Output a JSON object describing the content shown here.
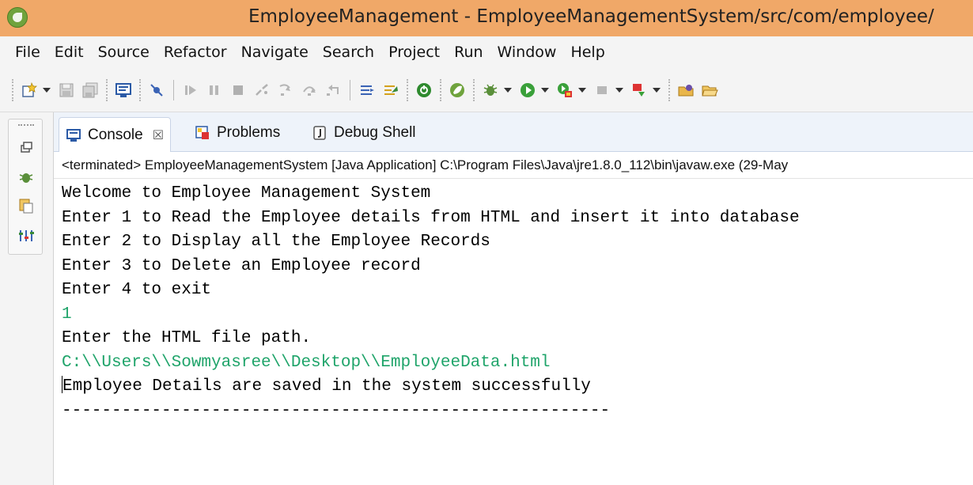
{
  "window": {
    "title": "EmployeeManagement - EmployeeManagementSystem/src/com/employee/"
  },
  "menu": [
    "File",
    "Edit",
    "Source",
    "Refactor",
    "Navigate",
    "Search",
    "Project",
    "Run",
    "Window",
    "Help"
  ],
  "toolbar": {
    "icons": [
      "new-wizard-icon",
      "save-icon",
      "save-all-icon",
      "open-console-icon",
      "skip-breakpoints-icon",
      "resume-icon",
      "suspend-icon",
      "terminate-icon",
      "disconnect-icon",
      "step-into-icon",
      "step-over-icon",
      "step-return-icon",
      "use-step-filters-icon",
      "drop-to-frame-icon",
      "spring-boot-icon",
      "spring-icon",
      "debug-icon",
      "run-icon",
      "coverage-icon",
      "stop-icon",
      "external-tools-icon",
      "open-type-icon",
      "open-folder-icon"
    ]
  },
  "view": {
    "tabs": [
      {
        "label": "Console",
        "icon": "console-icon",
        "active": true,
        "close": "☒"
      },
      {
        "label": "Problems",
        "icon": "problems-icon",
        "active": false
      },
      {
        "label": "Debug Shell",
        "icon": "debug-shell-icon",
        "active": false
      }
    ],
    "status": "<terminated> EmployeeManagementSystem [Java Application] C:\\Program Files\\Java\\jre1.8.0_112\\bin\\javaw.exe (29-May"
  },
  "console": {
    "lines": [
      {
        "text": "Welcome to Employee Management System",
        "kind": "output"
      },
      {
        "text": "Enter 1 to Read the Employee details from HTML and insert it into database",
        "kind": "output"
      },
      {
        "text": "Enter 2 to Display all the Employee Records",
        "kind": "output"
      },
      {
        "text": "Enter 3 to Delete an Employee record",
        "kind": "output"
      },
      {
        "text": "Enter 4 to exit",
        "kind": "output"
      },
      {
        "text": "1",
        "kind": "input"
      },
      {
        "text": "Enter the HTML file path.",
        "kind": "output"
      },
      {
        "text": "C:\\\\Users\\\\Sowmyasree\\\\Desktop\\\\EmployeeData.html",
        "kind": "input"
      },
      {
        "text": "Employee Details are saved in the system successfully",
        "kind": "output"
      },
      {
        "text": "-------------------------------------------------------",
        "kind": "output"
      }
    ]
  },
  "colors": {
    "titlebar": "#f0a868",
    "input_text": "#1fa46a",
    "chrome": "#f4f4f4",
    "tab_strip": "#eef3fa"
  }
}
